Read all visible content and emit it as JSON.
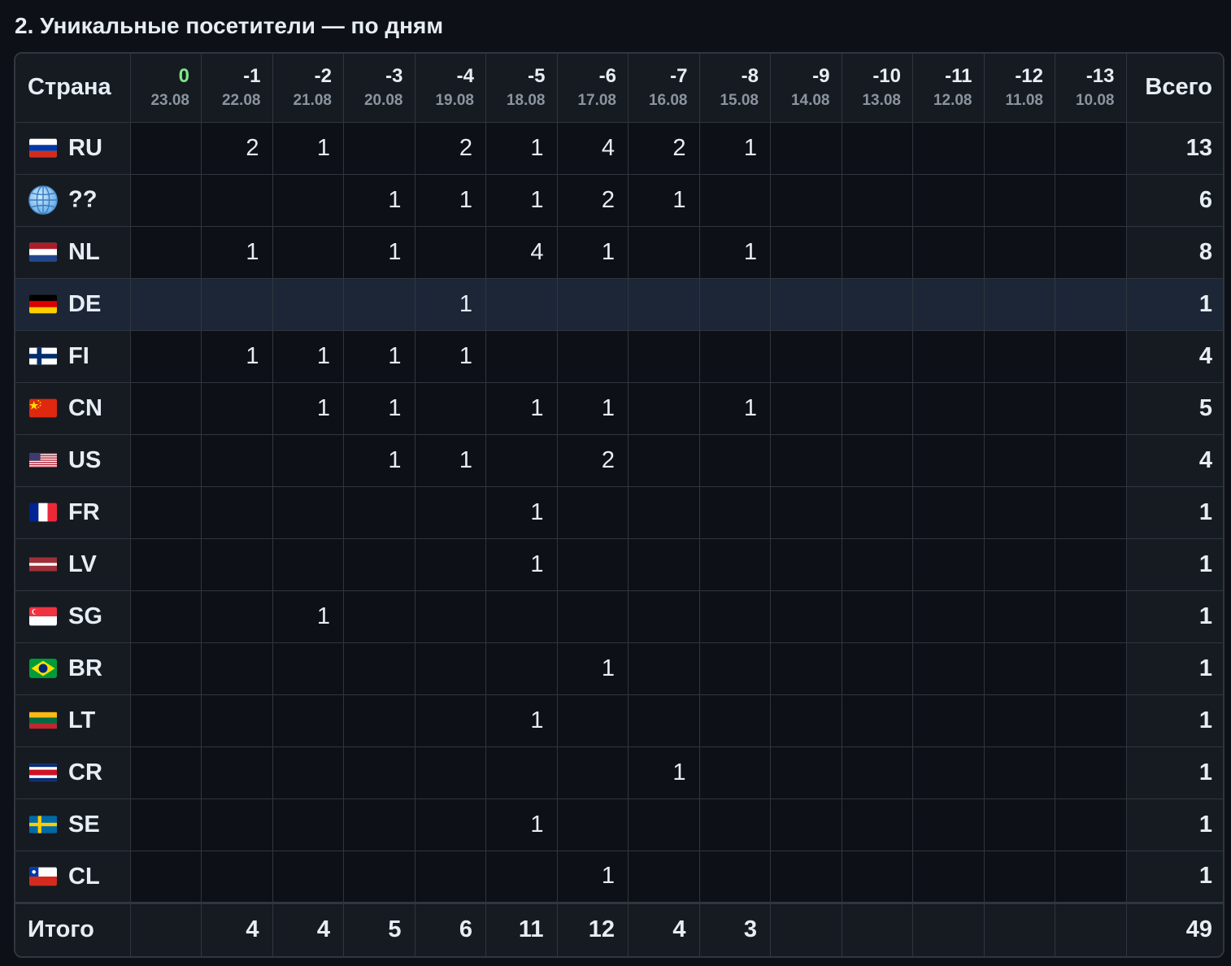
{
  "title": "2. Уникальные посетители — по дням",
  "header": {
    "country_label": "Страна",
    "total_label": "Всего",
    "days": [
      {
        "offset": "0",
        "date": "23.08"
      },
      {
        "offset": "-1",
        "date": "22.08"
      },
      {
        "offset": "-2",
        "date": "21.08"
      },
      {
        "offset": "-3",
        "date": "20.08"
      },
      {
        "offset": "-4",
        "date": "19.08"
      },
      {
        "offset": "-5",
        "date": "18.08"
      },
      {
        "offset": "-6",
        "date": "17.08"
      },
      {
        "offset": "-7",
        "date": "16.08"
      },
      {
        "offset": "-8",
        "date": "15.08"
      },
      {
        "offset": "-9",
        "date": "14.08"
      },
      {
        "offset": "-10",
        "date": "13.08"
      },
      {
        "offset": "-11",
        "date": "12.08"
      },
      {
        "offset": "-12",
        "date": "11.08"
      },
      {
        "offset": "-13",
        "date": "10.08"
      }
    ]
  },
  "rows": [
    {
      "code": "RU",
      "flag": "flag-ru-icon",
      "values": [
        "",
        "2",
        "1",
        "",
        "2",
        "1",
        "4",
        "2",
        "1",
        "",
        "",
        "",
        "",
        ""
      ],
      "total": "13"
    },
    {
      "code": "??",
      "flag": "globe-icon",
      "values": [
        "",
        "",
        "",
        "1",
        "1",
        "1",
        "2",
        "1",
        "",
        "",
        "",
        "",
        "",
        ""
      ],
      "total": "6"
    },
    {
      "code": "NL",
      "flag": "flag-nl-icon",
      "values": [
        "",
        "1",
        "",
        "1",
        "",
        "4",
        "1",
        "",
        "1",
        "",
        "",
        "",
        "",
        ""
      ],
      "total": "8"
    },
    {
      "code": "DE",
      "flag": "flag-de-icon",
      "values": [
        "",
        "",
        "",
        "",
        "1",
        "",
        "",
        "",
        "",
        "",
        "",
        "",
        "",
        ""
      ],
      "total": "1"
    },
    {
      "code": "FI",
      "flag": "flag-fi-icon",
      "values": [
        "",
        "1",
        "1",
        "1",
        "1",
        "",
        "",
        "",
        "",
        "",
        "",
        "",
        "",
        ""
      ],
      "total": "4"
    },
    {
      "code": "CN",
      "flag": "flag-cn-icon",
      "values": [
        "",
        "",
        "1",
        "1",
        "",
        "1",
        "1",
        "",
        "1",
        "",
        "",
        "",
        "",
        ""
      ],
      "total": "5"
    },
    {
      "code": "US",
      "flag": "flag-us-icon",
      "values": [
        "",
        "",
        "",
        "1",
        "1",
        "",
        "2",
        "",
        "",
        "",
        "",
        "",
        "",
        ""
      ],
      "total": "4"
    },
    {
      "code": "FR",
      "flag": "flag-fr-icon",
      "values": [
        "",
        "",
        "",
        "",
        "",
        "1",
        "",
        "",
        "",
        "",
        "",
        "",
        "",
        ""
      ],
      "total": "1"
    },
    {
      "code": "LV",
      "flag": "flag-lv-icon",
      "values": [
        "",
        "",
        "",
        "",
        "",
        "1",
        "",
        "",
        "",
        "",
        "",
        "",
        "",
        ""
      ],
      "total": "1"
    },
    {
      "code": "SG",
      "flag": "flag-sg-icon",
      "values": [
        "",
        "",
        "1",
        "",
        "",
        "",
        "",
        "",
        "",
        "",
        "",
        "",
        "",
        ""
      ],
      "total": "1"
    },
    {
      "code": "BR",
      "flag": "flag-br-icon",
      "values": [
        "",
        "",
        "",
        "",
        "",
        "",
        "1",
        "",
        "",
        "",
        "",
        "",
        "",
        ""
      ],
      "total": "1"
    },
    {
      "code": "LT",
      "flag": "flag-lt-icon",
      "values": [
        "",
        "",
        "",
        "",
        "",
        "1",
        "",
        "",
        "",
        "",
        "",
        "",
        "",
        ""
      ],
      "total": "1"
    },
    {
      "code": "CR",
      "flag": "flag-cr-icon",
      "values": [
        "",
        "",
        "",
        "",
        "",
        "",
        "",
        "1",
        "",
        "",
        "",
        "",
        "",
        ""
      ],
      "total": "1"
    },
    {
      "code": "SE",
      "flag": "flag-se-icon",
      "values": [
        "",
        "",
        "",
        "",
        "",
        "1",
        "",
        "",
        "",
        "",
        "",
        "",
        "",
        ""
      ],
      "total": "1"
    },
    {
      "code": "CL",
      "flag": "flag-cl-icon",
      "values": [
        "",
        "",
        "",
        "",
        "",
        "",
        "1",
        "",
        "",
        "",
        "",
        "",
        "",
        ""
      ],
      "total": "1"
    }
  ],
  "footer": {
    "label": "Итого",
    "values": [
      "",
      "4",
      "4",
      "5",
      "6",
      "11",
      "12",
      "4",
      "3",
      "",
      "",
      "",
      "",
      ""
    ],
    "total": "49"
  },
  "colors": {
    "background": "#0d1117",
    "header_bg": "#161b22",
    "border": "#30363d",
    "today_accent": "#7ee787",
    "highlight_row": "#1c2637",
    "muted_text": "#8b949e"
  },
  "highlighted_row": "DE"
}
